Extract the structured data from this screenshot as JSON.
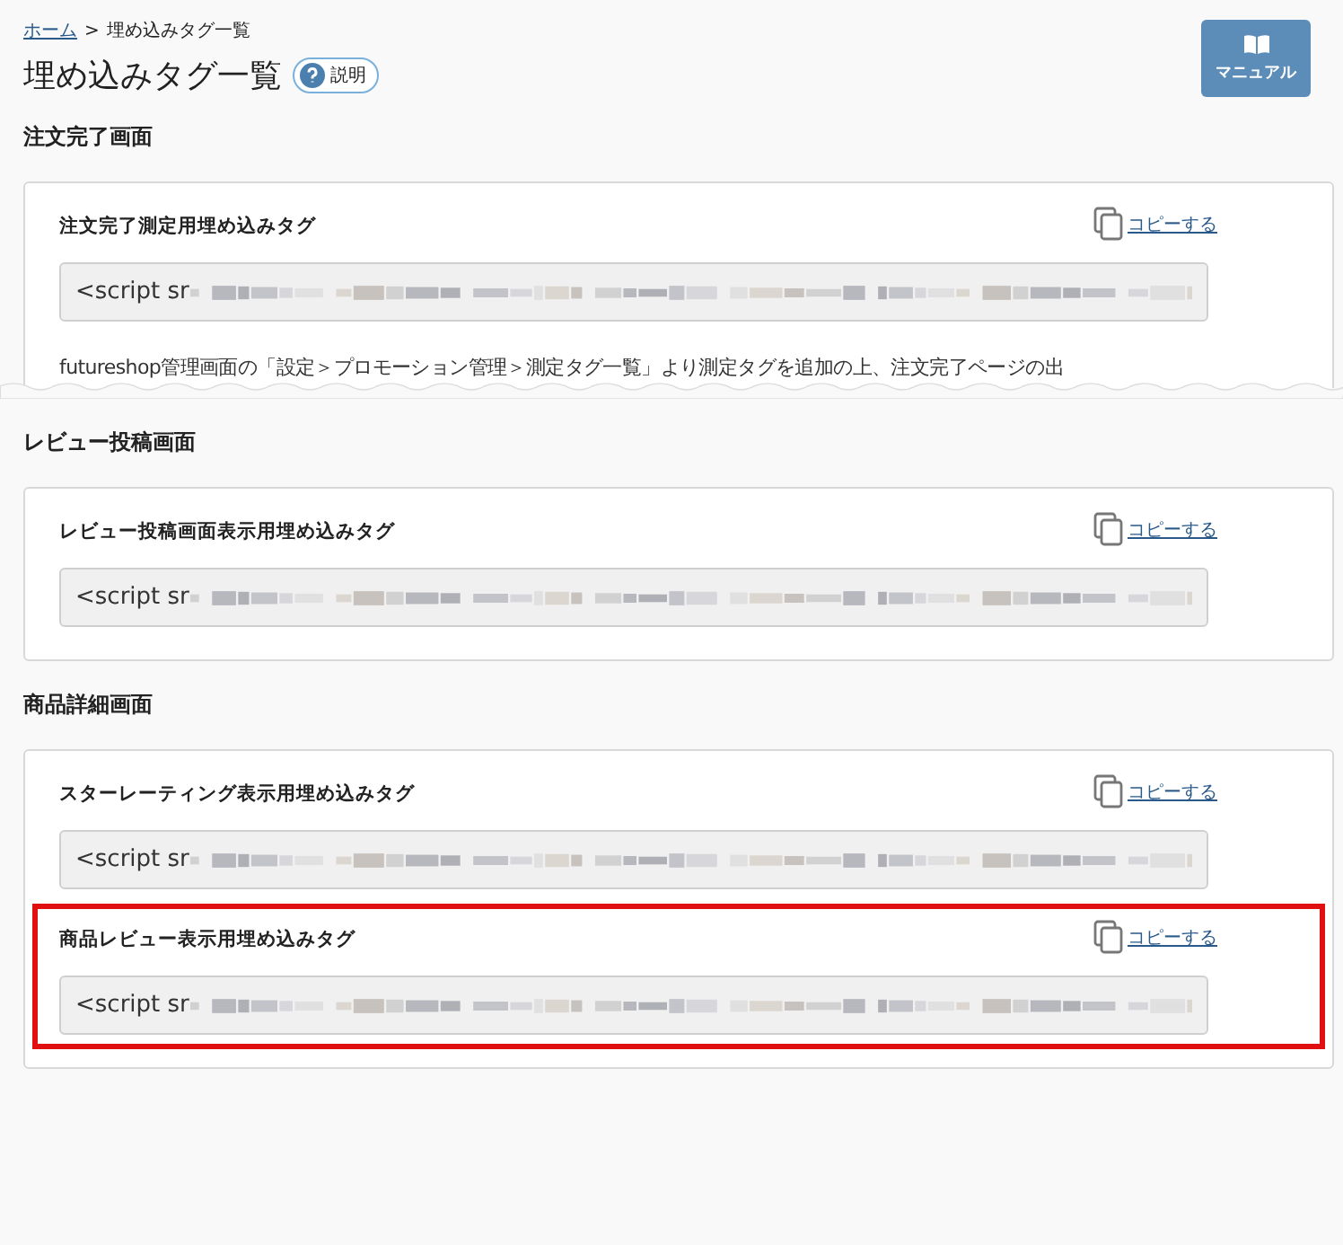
{
  "breadcrumb": [
    {
      "label": "ホーム",
      "link": true
    },
    {
      "label": ">",
      "link": false
    },
    {
      "label": "埋め込みタグ一覧",
      "link": false
    }
  ],
  "title": "埋め込みタグ一覧",
  "help_badge": "説明",
  "manual_button": "マニュアル",
  "sections": [
    {
      "title": "注文完了画面",
      "torn": true,
      "tags": [
        {
          "label": "注文完了測定用埋め込みタグ",
          "copy": "コピーする",
          "value": "<script sr",
          "highlighted": false
        }
      ],
      "note": "futureshop管理画面の「設定＞プロモーション管理＞測定タグ一覧」より測定タグを追加の上、注文完了ページの出"
    },
    {
      "title": "レビュー投稿画面",
      "torn": false,
      "tags": [
        {
          "label": "レビュー投稿画面表示用埋め込みタグ",
          "copy": "コピーする",
          "value": "<script sr",
          "highlighted": false
        }
      ]
    },
    {
      "title": "商品詳細画面",
      "torn": false,
      "tags": [
        {
          "label": "スターレーティング表示用埋め込みタグ",
          "copy": "コピーする",
          "value": "<script sr",
          "highlighted": false
        },
        {
          "label": "商品レビュー表示用埋め込みタグ",
          "copy": "コピーする",
          "value": "<script sr",
          "highlighted": true
        }
      ]
    }
  ]
}
